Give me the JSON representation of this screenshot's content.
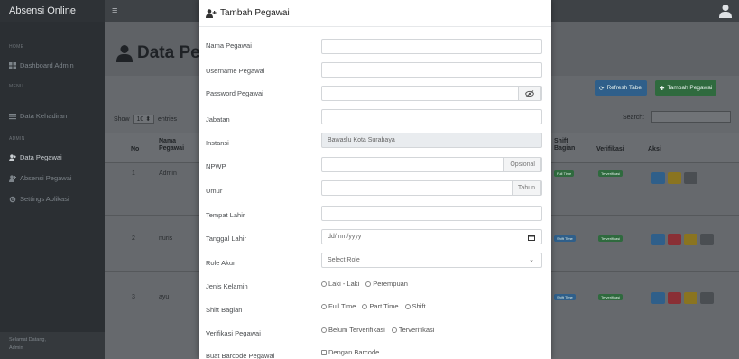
{
  "app": {
    "brand": "Absensi Online",
    "menu_icon": "hamburger-icon",
    "user_icon": "user-icon"
  },
  "sidebar": {
    "sections": [
      {
        "title": "HOME",
        "items": [
          {
            "label": "Dashboard Admin",
            "icon": "dashboard-icon"
          }
        ]
      },
      {
        "title": "MENU",
        "items": [
          {
            "label": "Data Kehadiran",
            "icon": "list-icon"
          }
        ]
      },
      {
        "title": "ADMIN",
        "items": [
          {
            "label": "Data Pegawai",
            "icon": "users-icon",
            "active": true
          },
          {
            "label": "Absensi Pegawai",
            "icon": "user-add-icon"
          },
          {
            "label": "Settings Aplikasi",
            "icon": "gear-icon"
          }
        ]
      }
    ],
    "footer": {
      "line1": "Selamat Datang,",
      "line2": "Admin"
    }
  },
  "main": {
    "page_title": "Data Pe",
    "toolbar": {
      "refresh_label": "Refresh Tabel",
      "add_label": "Tambah Pegawai"
    },
    "table_controls": {
      "show_label": "Show",
      "entries_value": "10",
      "entries_label": "entries",
      "search_label": "Search:"
    },
    "columns": {
      "no": "No",
      "nama_line1": "Nama",
      "nama_line2": "Pegawai",
      "shift_line1": "Shift",
      "shift_line2": "Bagian",
      "verifikasi": "Verifikasi",
      "aksi": "Aksi"
    },
    "rows": [
      {
        "no": "1",
        "nama": "Admin",
        "shift": "Full Time",
        "verifikasi": "Terverifikasi"
      },
      {
        "no": "2",
        "nama": "nuris",
        "shift": "Shift Time",
        "verifikasi": "Terverifikasi"
      },
      {
        "no": "3",
        "nama": "ayu",
        "shift": "Shift Time",
        "verifikasi": "Terverifikasi"
      }
    ]
  },
  "modal": {
    "title": "Tambah Pegawai",
    "title_icon": "user-add-icon",
    "fields": {
      "nama": {
        "label": "Nama Pegawai",
        "value": ""
      },
      "username": {
        "label": "Username Pegawai",
        "value": ""
      },
      "password": {
        "label": "Password Pegawai",
        "value": "",
        "toggle_icon": "eye-slash-icon"
      },
      "jabatan": {
        "label": "Jabatan",
        "value": ""
      },
      "instansi": {
        "label": "Instansi",
        "value": "Bawaslu Kota Surabaya"
      },
      "npwp": {
        "label": "NPWP",
        "value": "",
        "addon": "Opsional"
      },
      "umur": {
        "label": "Umur",
        "value": "",
        "addon": "Tahun"
      },
      "tempat_lahir": {
        "label": "Tempat Lahir",
        "value": ""
      },
      "tanggal_lahir": {
        "label": "Tanggal Lahir",
        "placeholder": "dd/mm/yyyy",
        "icon": "calendar-icon"
      },
      "role": {
        "label": "Role Akun",
        "selected": "Select Role",
        "icon": "chevron-down-icon"
      },
      "jenis_kelamin": {
        "label": "Jenis Kelamin",
        "options": [
          "Laki - Laki",
          "Perempuan"
        ]
      },
      "shift_bagian": {
        "label": "Shift Bagian",
        "options": [
          "Full Time",
          "Part Time",
          "Shift"
        ]
      },
      "verifikasi": {
        "label": "Verifikasi Pegawai",
        "options": [
          "Belum Terverifikasi",
          "Terverifikasi"
        ]
      },
      "barcode": {
        "label": "Buat Barcode Pegawai",
        "option": "Dengan Barcode"
      }
    }
  },
  "colors": {
    "brand_bg": "#2e3236",
    "sidebar_bg": "#2b2f33",
    "button_blue": "#2f5f8a",
    "button_green": "#2f6a3e",
    "badge_green": "#2f6a3e",
    "badge_blue": "#2f5f8a",
    "action_yellow": "#8a7420",
    "action_red": "#8a2f35",
    "action_gray": "#4a4e52",
    "modal_bg": "#ffffff",
    "readonly_bg": "#e9ecef"
  }
}
